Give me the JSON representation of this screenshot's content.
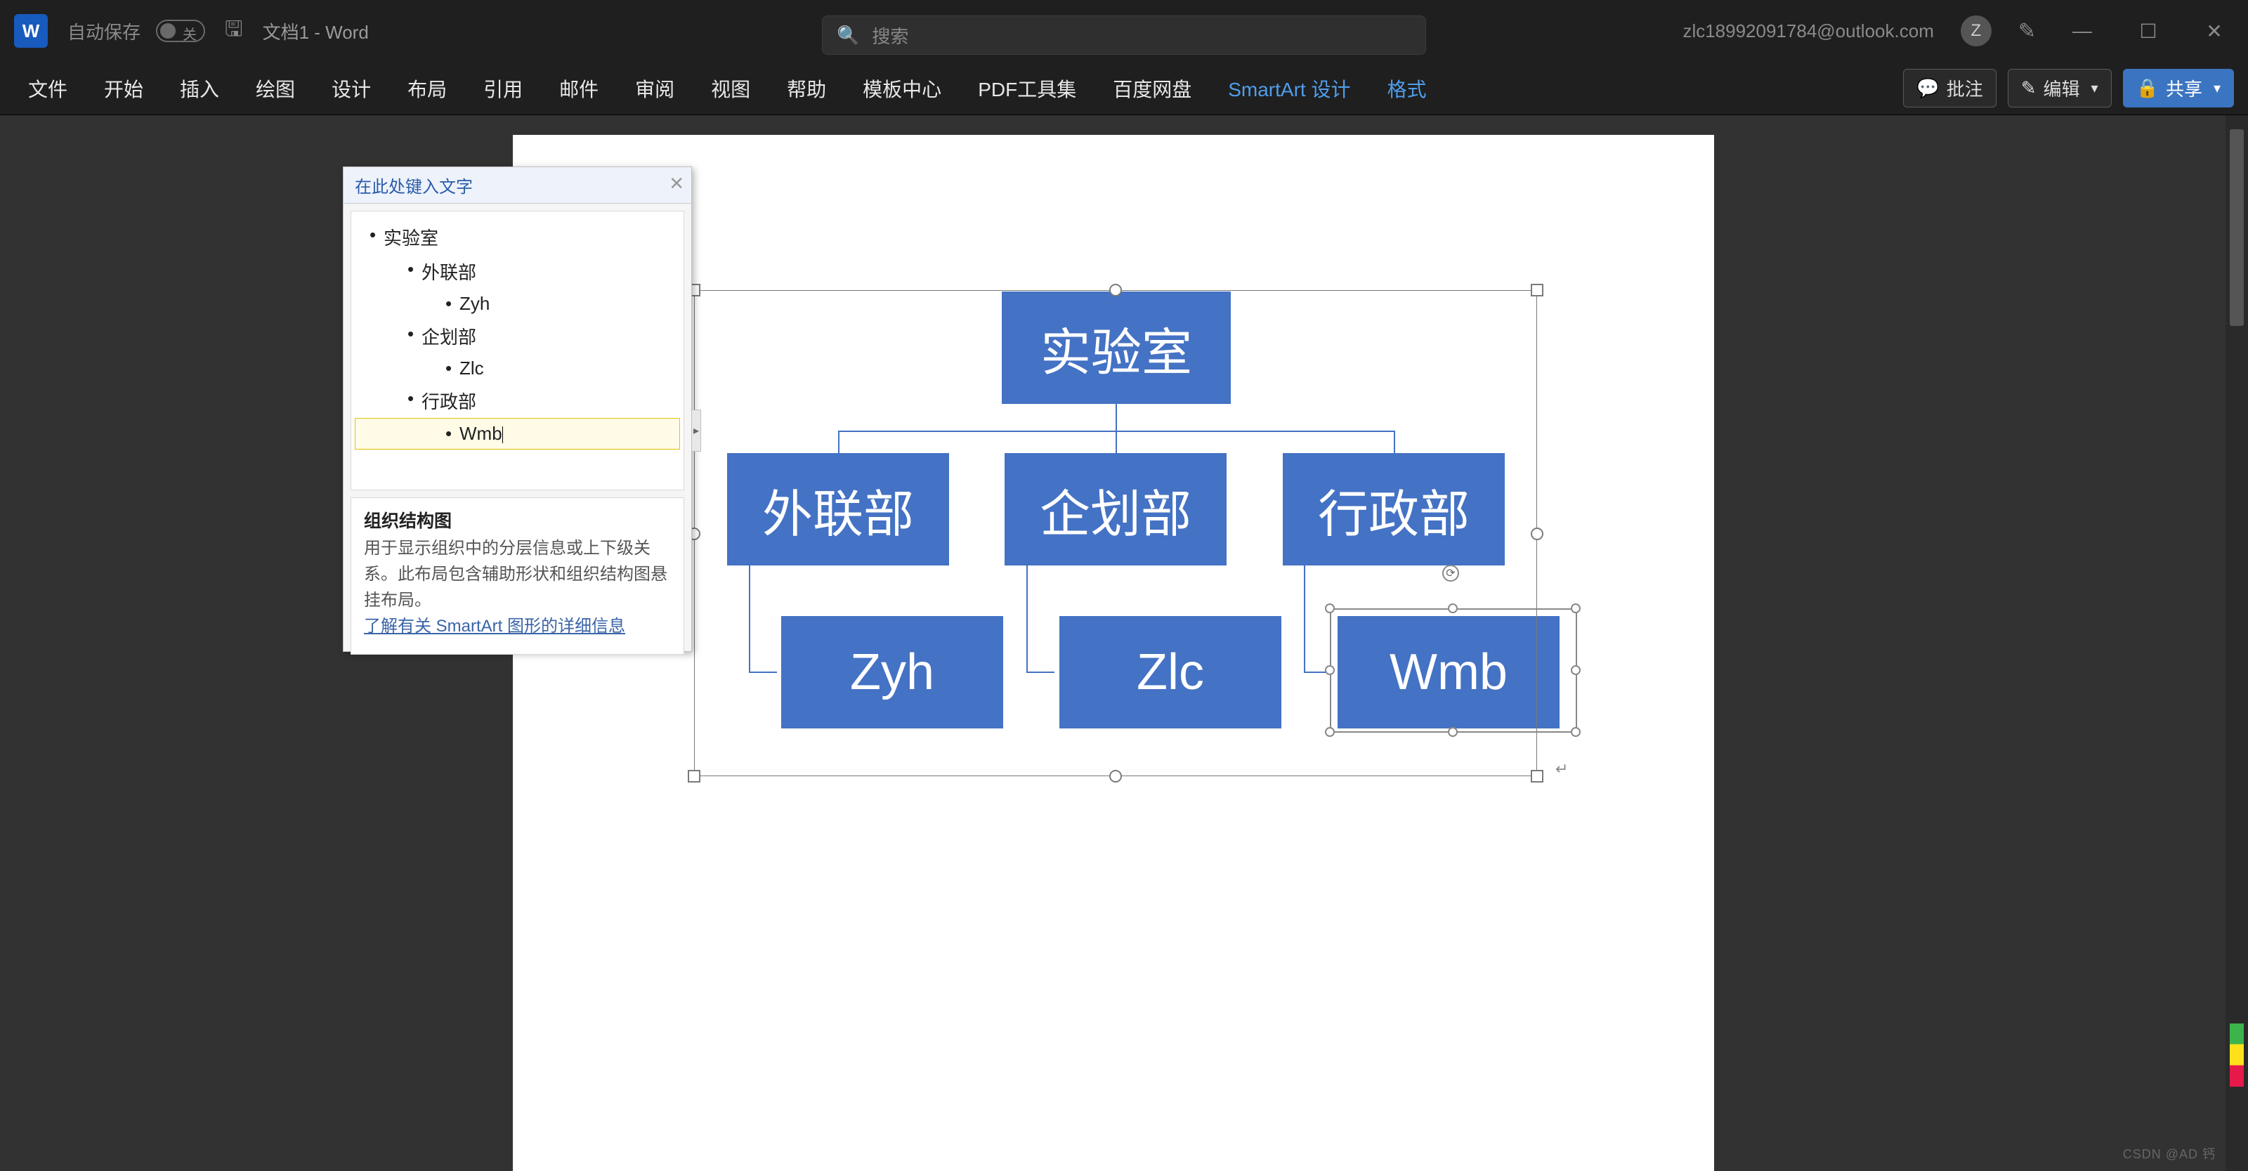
{
  "title_bar": {
    "word_icon_label": "W",
    "autosave_label": "自动保存",
    "autosave_off": "关",
    "doc_title": "文档1  -  Word",
    "search_placeholder": "搜索",
    "user_email": "zlc18992091784@outlook.com",
    "avatar_letter": "Z"
  },
  "ribbon": {
    "tabs": [
      "文件",
      "开始",
      "插入",
      "绘图",
      "设计",
      "布局",
      "引用",
      "邮件",
      "审阅",
      "视图",
      "帮助",
      "模板中心",
      "PDF工具集",
      "百度网盘",
      "SmartArt 设计",
      "格式"
    ],
    "active_tabs": [
      "SmartArt 设计",
      "格式"
    ],
    "right": {
      "comment": "批注",
      "edit": "编辑",
      "share": "共享"
    }
  },
  "text_pane": {
    "title": "在此处键入文字",
    "items": [
      {
        "level": 1,
        "text": "实验室"
      },
      {
        "level": 2,
        "text": "外联部"
      },
      {
        "level": 3,
        "text": "Zyh"
      },
      {
        "level": 2,
        "text": "企划部"
      },
      {
        "level": 3,
        "text": "Zlc"
      },
      {
        "level": 2,
        "text": "行政部"
      },
      {
        "level": 3,
        "text": "Wmb",
        "editing": true
      }
    ],
    "info_title": "组织结构图",
    "info_body": "用于显示组织中的分层信息或上下级关系。此布局包含辅助形状和组织结构图悬挂布局。",
    "info_link": "了解有关 SmartArt 图形的详细信息"
  },
  "chart": {
    "root": "实验室",
    "row2": [
      "外联部",
      "企划部",
      "行政部"
    ],
    "row3": [
      "Zyh",
      "Zlc",
      "Wmb"
    ]
  },
  "watermark": "CSDN @AD 钙"
}
